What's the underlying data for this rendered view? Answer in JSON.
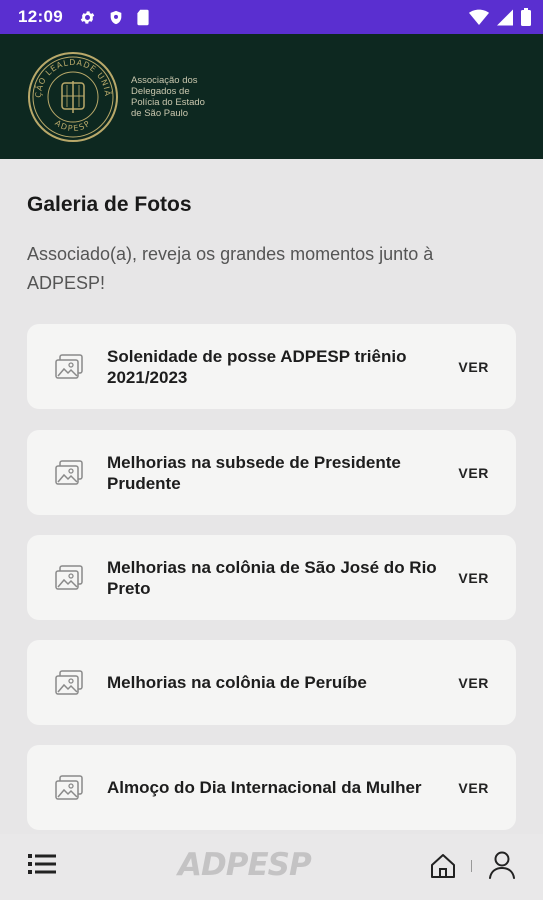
{
  "status_bar": {
    "time": "12:09",
    "icons": [
      "gear-icon",
      "shield-icon",
      "sim-card-icon",
      "wifi-icon",
      "signal-icon",
      "battery-icon"
    ]
  },
  "header": {
    "seal_text_top": "AÇÃO LEALDADE UNIÃO",
    "seal_text_bottom": "ADPESP",
    "org_name_lines": [
      "Associação dos",
      "Delegados de",
      "Polícia do Estado",
      "de São Paulo"
    ]
  },
  "page": {
    "title": "Galeria de Fotos",
    "subtitle": "Associado(a), reveja os grandes momentos junto à ADPESP!"
  },
  "gallery": {
    "action_label": "VER",
    "items": [
      {
        "title": "Solenidade de posse ADPESP triênio 2021/2023"
      },
      {
        "title": "Melhorias na subsede de Presidente Prudente"
      },
      {
        "title": "Melhorias na colônia de São José do Rio Preto"
      },
      {
        "title": "Melhorias na colônia de Peruíbe"
      },
      {
        "title": "Almoço do Dia Internacional da Mulher"
      }
    ]
  },
  "bottom_nav": {
    "brand": "ADPESP",
    "icons": [
      "menu-icon",
      "home-icon",
      "user-icon"
    ]
  },
  "colors": {
    "status_bar": "#5a2fd0",
    "header_bg": "#0d2820",
    "page_bg": "#e7e6e7",
    "card_bg": "#f5f5f4"
  }
}
